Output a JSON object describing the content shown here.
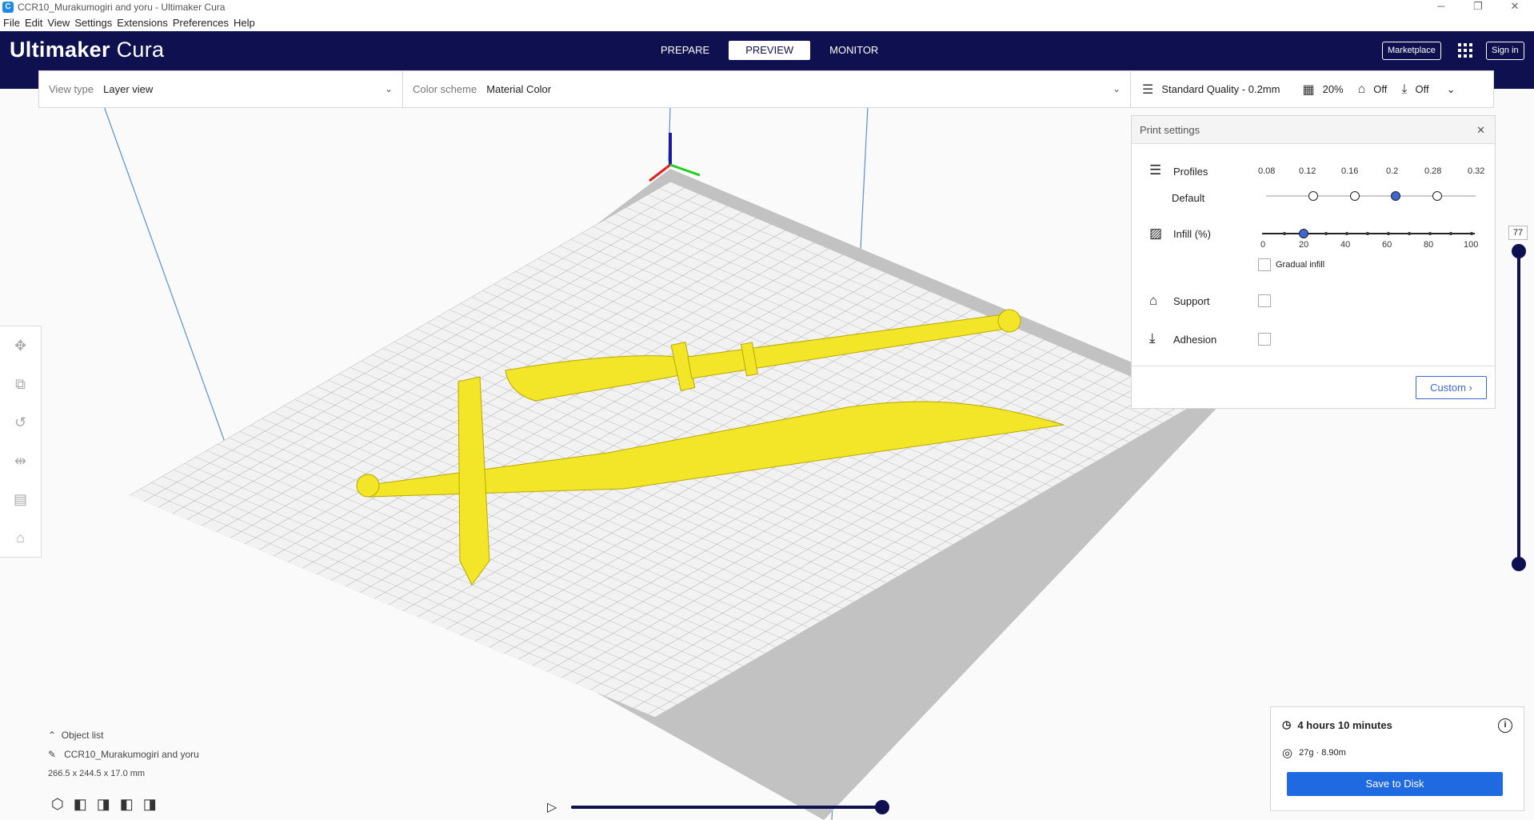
{
  "window": {
    "title": "CCR10_Murakumogiri and yoru - Ultimaker Cura",
    "app_icon": "cura-icon"
  },
  "menu": [
    "File",
    "Edit",
    "View",
    "Settings",
    "Extensions",
    "Preferences",
    "Help"
  ],
  "header": {
    "logo_main": "Ultimaker",
    "logo_sub": "Cura",
    "stages": [
      "PREPARE",
      "PREVIEW",
      "MONITOR"
    ],
    "active_stage": "PREVIEW",
    "marketplace": "Marketplace",
    "sign_in": "Sign in"
  },
  "viewbar": {
    "view_type_label": "View type",
    "view_type_value": "Layer view",
    "color_scheme_label": "Color scheme",
    "color_scheme_value": "Material Color"
  },
  "quality": {
    "profile": "Standard Quality - 0.2mm",
    "infill": "20%",
    "support": "Off",
    "adhesion": "Off"
  },
  "print_settings": {
    "title": "Print settings",
    "profiles_label": "Profiles",
    "default_label": "Default",
    "profile_ticks": [
      "0.08",
      "0.12",
      "0.16",
      "0.2",
      "0.28",
      "0.32"
    ],
    "selected_profile": "0.2",
    "infill_label": "Infill (%)",
    "infill_ticks": [
      "0",
      "20",
      "40",
      "60",
      "80",
      "100"
    ],
    "infill_value": 20,
    "gradual_infill": "Gradual infill",
    "support_label": "Support",
    "adhesion_label": "Adhesion",
    "custom_button": "Custom"
  },
  "layer_slider": {
    "current": "77"
  },
  "objects": {
    "toggle": "Object list",
    "name": "CCR10_Murakumogiri and yoru",
    "dimensions": "266.5 x 244.5 x 17.0 mm"
  },
  "estimate": {
    "time": "4 hours 10 minutes",
    "material": "27g · 8.90m",
    "save": "Save to Disk"
  },
  "colors": {
    "header": "#0e1050",
    "accent": "#1f6ae0",
    "model": "#f3e628"
  }
}
